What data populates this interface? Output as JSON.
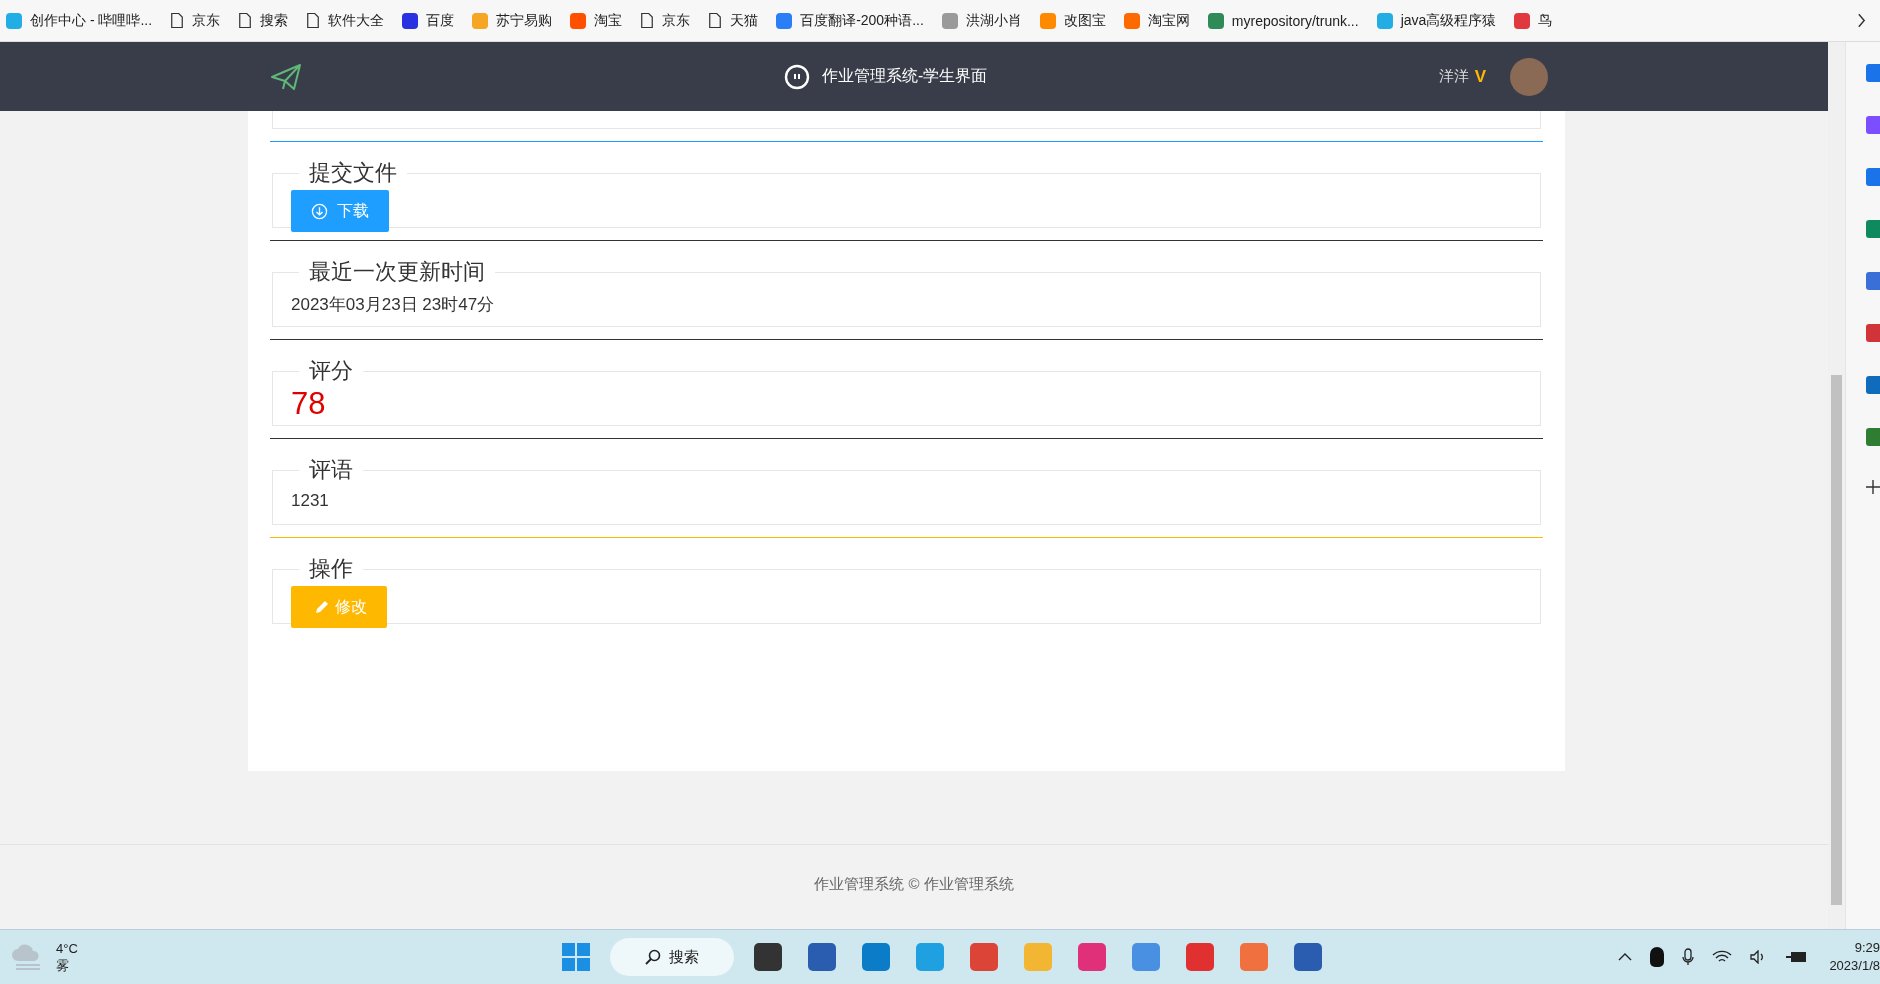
{
  "bookmarks": [
    {
      "label": "创作中心 - 哔哩哔...",
      "kind": "site",
      "color": "#23ade5"
    },
    {
      "label": "京东",
      "kind": "page"
    },
    {
      "label": "搜索",
      "kind": "page"
    },
    {
      "label": "软件大全",
      "kind": "page"
    },
    {
      "label": "百度",
      "kind": "site",
      "color": "#2932e1"
    },
    {
      "label": "苏宁易购",
      "kind": "site",
      "color": "#f5a623"
    },
    {
      "label": "淘宝",
      "kind": "site",
      "color": "#ff5000"
    },
    {
      "label": "京东",
      "kind": "page"
    },
    {
      "label": "天猫",
      "kind": "page"
    },
    {
      "label": "百度翻译-200种语...",
      "kind": "site",
      "color": "#2b7ff6"
    },
    {
      "label": "洪湖小肖",
      "kind": "site",
      "color": "#9a9a9a"
    },
    {
      "label": "改图宝",
      "kind": "site",
      "color": "#ff8a00"
    },
    {
      "label": "淘宝网",
      "kind": "site",
      "color": "#ff6a00"
    },
    {
      "label": "myrepository/trunk...",
      "kind": "site",
      "color": "#2e8b57"
    },
    {
      "label": "java高级程序猿",
      "kind": "site",
      "color": "#23ade5"
    },
    {
      "label": "鸟",
      "kind": "site",
      "color": "#e0383e"
    }
  ],
  "header": {
    "title": "作业管理系统-学生界面",
    "user": "洋洋",
    "vip_mark": "V"
  },
  "sections": [
    {
      "legend": "提交文件",
      "color": "#1e9fff",
      "kind": "button",
      "button": {
        "label": "下载",
        "kind": "download"
      }
    },
    {
      "legend": "最近一次更新时间",
      "color": "#333333",
      "kind": "text",
      "value": "2023年03月23日 23时47分"
    },
    {
      "legend": "评分",
      "color": "#333333",
      "kind": "score",
      "value": "78"
    },
    {
      "legend": "评语",
      "color": "#333333",
      "kind": "text",
      "value": "1231"
    },
    {
      "legend": "操作",
      "color": "#ffb800",
      "kind": "button",
      "button": {
        "label": "修改",
        "kind": "edit"
      }
    }
  ],
  "footer": "作业管理系统 ©  作业管理系统",
  "taskbar": {
    "temperature": "4°C",
    "weather": "雾",
    "search": "搜索",
    "time": "9:29",
    "date": "2023/1/8"
  }
}
